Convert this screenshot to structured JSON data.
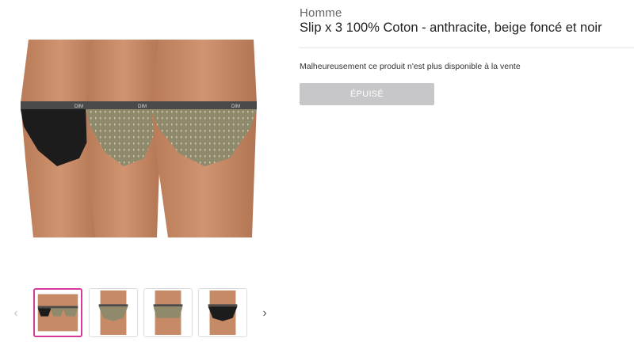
{
  "product": {
    "category": "Homme",
    "title": "Slip x 3 100% Coton - anthracite, beige foncé et noir",
    "availability_notice": "Malheureusement ce produit n'est plus disponible à la vente",
    "soldout_label": "ÉPUISÉ"
  },
  "gallery": {
    "main_image_alt": "Slip x 3 100% Coton - anthracite, beige foncé et noir",
    "waistband_brand_text": "DIM",
    "prev_icon": "chevron-left-icon",
    "next_icon": "chevron-right-icon",
    "prev_glyph": "‹",
    "next_glyph": "›",
    "thumbnails": [
      {
        "name": "thumbnail-1",
        "active": true
      },
      {
        "name": "thumbnail-2",
        "active": false
      },
      {
        "name": "thumbnail-3",
        "active": false
      },
      {
        "name": "thumbnail-4",
        "active": false
      }
    ]
  },
  "colors": {
    "skin": "#c68a66",
    "waistband": "#4a4a4a",
    "black_brief": "#1c1c1c",
    "beige_brief": "#8f8a6c",
    "active_thumb_border": "#d63a9a",
    "soldout_button_bg": "#c7c7c9"
  }
}
